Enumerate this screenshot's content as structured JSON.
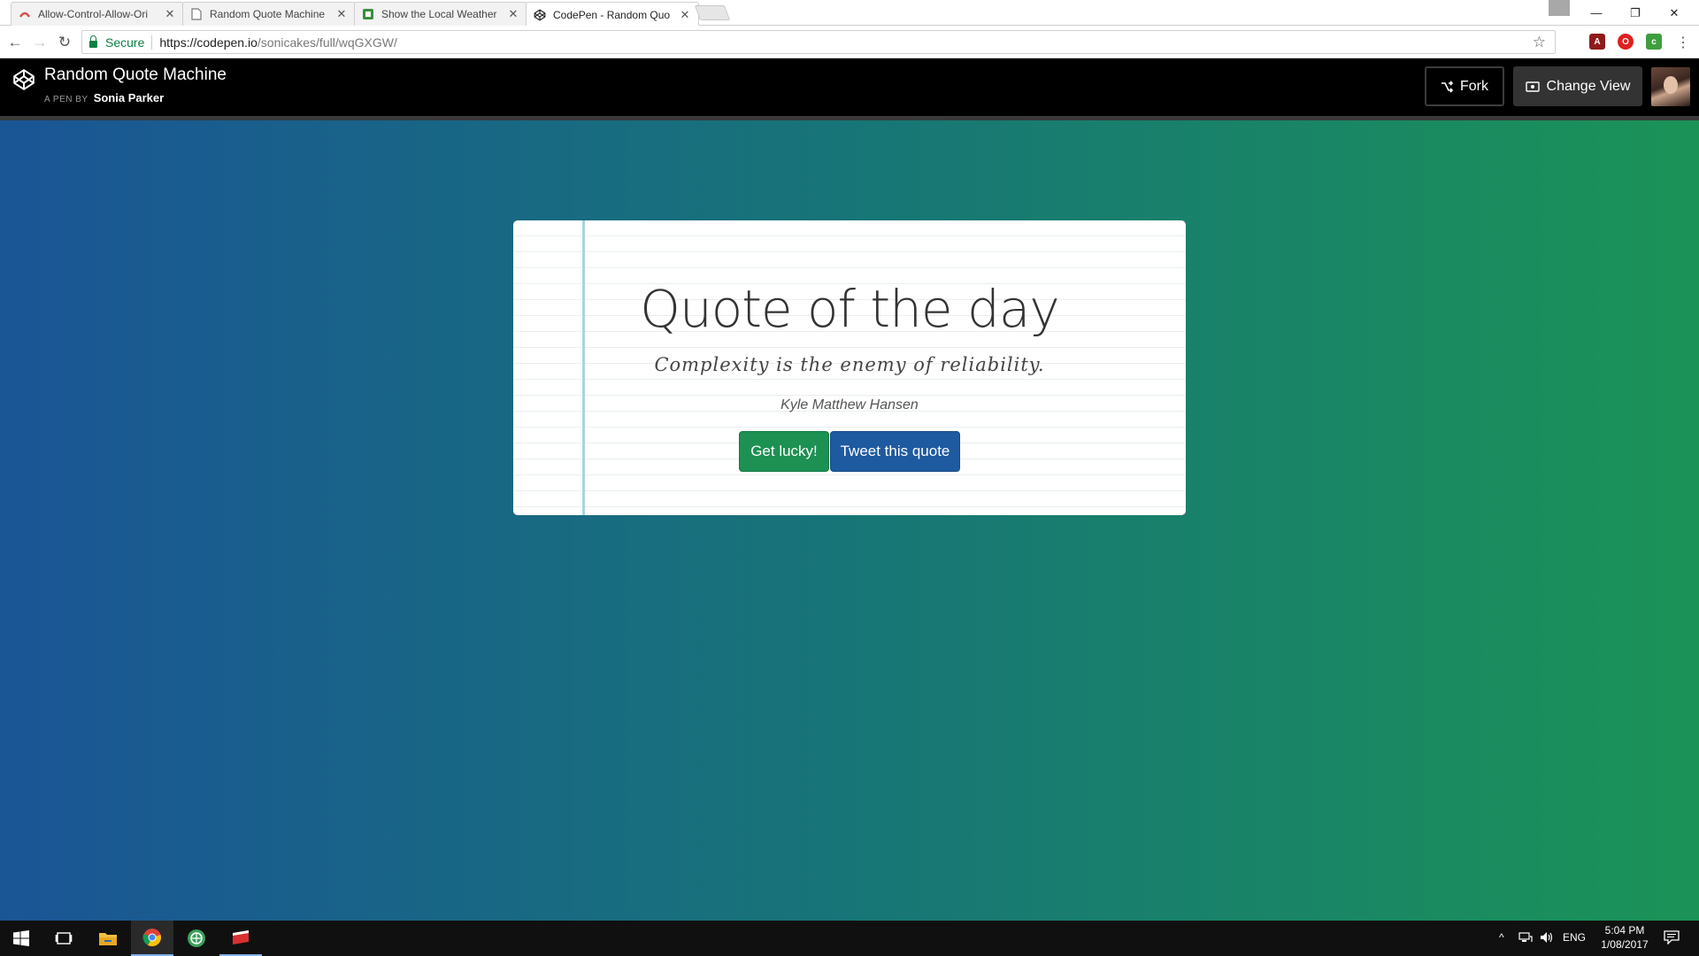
{
  "browser": {
    "tabs": [
      {
        "title": "Allow-Control-Allow-Ori",
        "icon": "extension-icon",
        "active": false
      },
      {
        "title": "Random Quote Machine",
        "icon": "page-icon",
        "active": false
      },
      {
        "title": "Show the Local Weather",
        "icon": "weather-icon",
        "active": false
      },
      {
        "title": "CodePen - Random Quo",
        "icon": "codepen-icon",
        "active": true
      }
    ],
    "secure_label": "Secure",
    "url_host": "https://codepen.io",
    "url_path": "/sonicakes/full/wqGXGW/"
  },
  "codepen": {
    "title": "Random Quote Machine",
    "byline": "A PEN BY",
    "author": "Sonia Parker",
    "fork_label": "Fork",
    "change_view_label": "Change View"
  },
  "quote_card": {
    "heading": "Quote of the day",
    "quote": "Complexity is the enemy of reliability.",
    "author": "Kyle Matthew Hansen",
    "lucky_label": "Get lucky!",
    "tweet_label": "Tweet this quote"
  },
  "taskbar": {
    "language": "ENG",
    "time": "5:04 PM",
    "date": "1/08/2017"
  },
  "colors": {
    "gradient_start": "#1a5596",
    "gradient_end": "#1b9357",
    "lucky_button": "#1c9152",
    "tweet_button": "#1e5aa0",
    "margin_line": "#a9d6da"
  }
}
